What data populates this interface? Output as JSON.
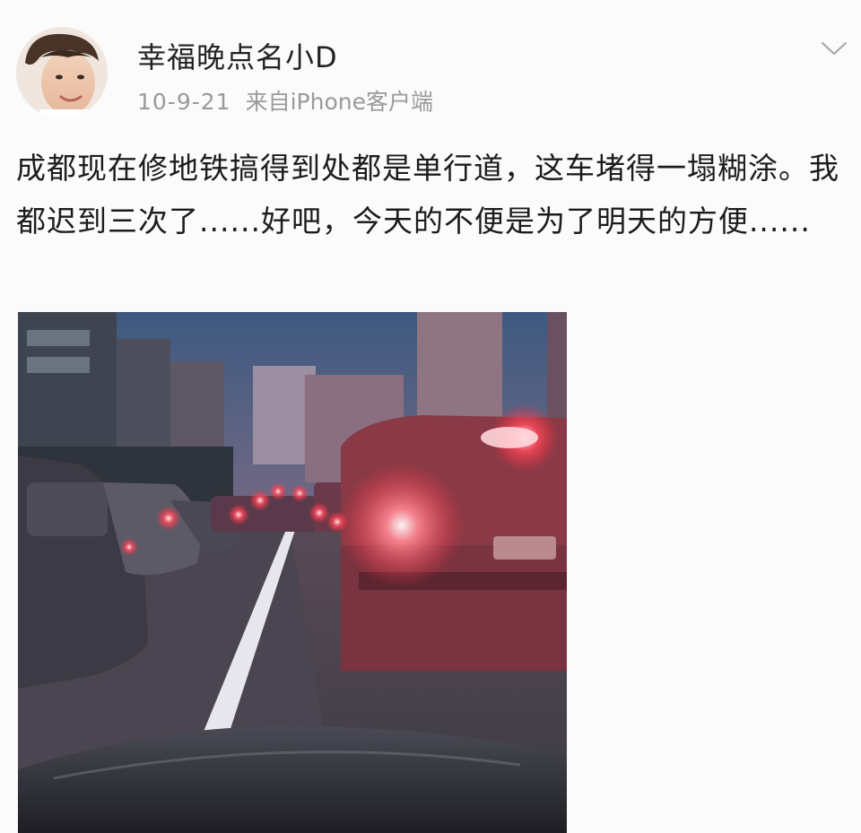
{
  "post": {
    "author_name": "幸福晚点名小D",
    "date": "10-9-21",
    "source": "来自iPhone客户端",
    "text": "成都现在修地铁搞得到处都是单行道，这车堵得一塌糊涂。我都迟到三次了......好吧，今天的不便是为了明天的方便......"
  },
  "icons": {
    "menu": "chevron-down-icon",
    "avatar": "user-portrait"
  },
  "photo": {
    "subject": "traffic-jam-photo"
  },
  "colors": {
    "name": "#222222",
    "meta": "#9a9a9a",
    "body": "#1c1c1c",
    "brake_light": "#ff2a3c"
  }
}
